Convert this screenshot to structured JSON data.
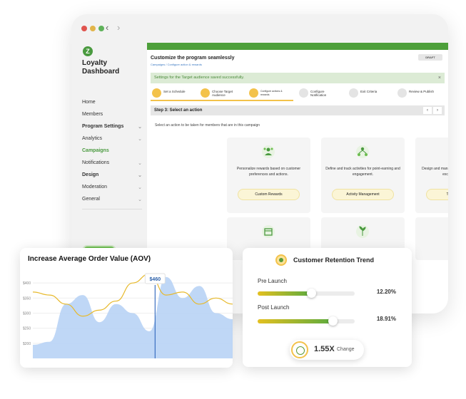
{
  "colors": {
    "brand": "#4d9f3a",
    "accent": "#f3c24a",
    "chart_fill": "#b8d3f5",
    "chart_line": "#e7b92b"
  },
  "sidebar": {
    "logo_letter": "Z",
    "brand": "Loyalty Dashboard",
    "items": [
      {
        "label": "Home"
      },
      {
        "label": "Members"
      },
      {
        "label": "Program Settings"
      },
      {
        "label": "Analytics"
      },
      {
        "label": "Campaigns"
      },
      {
        "label": "Notifications"
      },
      {
        "label": "Design"
      },
      {
        "label": "Moderation"
      },
      {
        "label": "General"
      }
    ],
    "status": "ACTIVE"
  },
  "main": {
    "title": "Customize the program seamlessly",
    "breadcrumb": "Campaigns  /  Configure action & rewards",
    "draft_label": "DRAFT",
    "success_message": "Settings for the Target audience saved successfully.",
    "steps": [
      {
        "label": "Set a Schedule"
      },
      {
        "label": "Choose Target Audience"
      },
      {
        "label": "Configure actions & rewards"
      },
      {
        "label": "Configure Notification"
      },
      {
        "label": "Exit Criteria"
      },
      {
        "label": "Review & Publish"
      }
    ],
    "step_heading": "Step 3: Select an action",
    "instruction": "Select an action to be taken for members that are in this campaign",
    "cards": [
      {
        "desc": "Personalize rewards based on customer preferences and actions.",
        "button": "Custom Rewards",
        "icon": "rewards-icon"
      },
      {
        "desc": "Define and track activities for point-earning and engagement.",
        "button": "Activity Management",
        "icon": "activity-icon"
      },
      {
        "desc": "Design and manage tiered loyalty levels with exclusive benefits.",
        "button": "Tier Structure",
        "icon": "tier-icon"
      }
    ]
  },
  "aov": {
    "title": "Increase Average Order Value (AOV)",
    "tooltip": "$460",
    "chart_data": {
      "type": "area",
      "y_ticks": [
        "$400",
        "$350",
        "$300",
        "$250",
        "$200"
      ],
      "ylim": [
        150,
        450
      ],
      "series": [
        {
          "values": [
            195,
            205,
            330,
            360,
            270,
            330,
            300,
            240,
            420,
            350,
            390,
            300,
            280
          ]
        },
        {
          "values": [
            370,
            360,
            330,
            290,
            310,
            340,
            400,
            430,
            360,
            370,
            330,
            350,
            330
          ]
        }
      ]
    }
  },
  "retention": {
    "title": "Customer Retention Trend",
    "pre_label": "Pre Launch",
    "pre_value": "12.20%",
    "pre_level": 0.55,
    "post_label": "Post Launch",
    "post_value": "18.91%",
    "post_level": 0.77,
    "change_value": "1.55X",
    "change_word": "Change"
  }
}
